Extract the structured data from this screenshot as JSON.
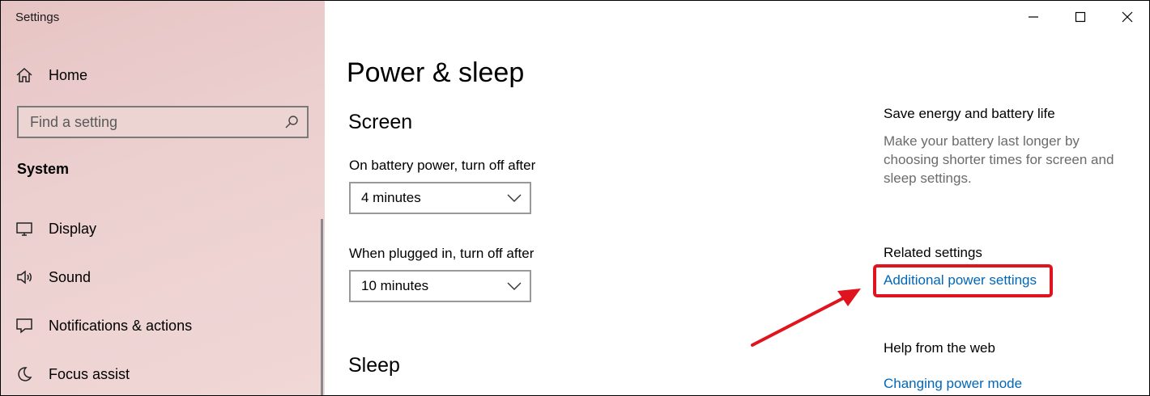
{
  "app": {
    "title": "Settings"
  },
  "sidebar": {
    "home_label": "Home",
    "search_placeholder": "Find a setting",
    "section": "System",
    "items": [
      {
        "label": "Display",
        "icon": "monitor-icon"
      },
      {
        "label": "Sound",
        "icon": "speaker-icon"
      },
      {
        "label": "Notifications & actions",
        "icon": "notification-icon"
      },
      {
        "label": "Focus assist",
        "icon": "moon-icon"
      }
    ]
  },
  "main": {
    "title": "Power & sleep",
    "screen": {
      "heading": "Screen",
      "battery_label": "On battery power, turn off after",
      "battery_value": "4 minutes",
      "plugged_label": "When plugged in, turn off after",
      "plugged_value": "10 minutes"
    },
    "sleep": {
      "heading": "Sleep"
    }
  },
  "aside": {
    "save_title": "Save energy and battery life",
    "save_desc": "Make your battery last longer by choosing shorter times for screen and sleep settings.",
    "related_title": "Related settings",
    "related_link": "Additional power settings",
    "help_title": "Help from the web",
    "help_link": "Changing power mode"
  },
  "colors": {
    "link": "#0067b8",
    "highlight": "#e0141e",
    "sidebar_bg": "#ecd0d0"
  }
}
